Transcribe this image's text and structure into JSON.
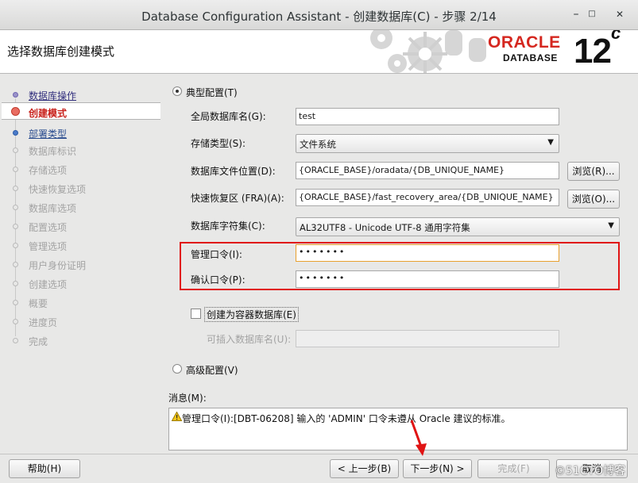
{
  "window": {
    "title": "Database Configuration Assistant - 创建数据库(C) - 步骤 2/14",
    "minimize": "–",
    "maximize": "□",
    "close": "✕"
  },
  "header": {
    "page_title": "选择数据库创建模式",
    "oracle": "ORACLE",
    "database": "DATABASE",
    "version": "12",
    "version_suffix": "c"
  },
  "sidebar": {
    "steps": [
      {
        "label": "数据库操作",
        "state": "done"
      },
      {
        "label": "创建模式",
        "state": "active"
      },
      {
        "label": "部署类型",
        "state": "next"
      },
      {
        "label": "数据库标识",
        "state": "disabled"
      },
      {
        "label": "存储选项",
        "state": "disabled"
      },
      {
        "label": "快速恢复选项",
        "state": "disabled"
      },
      {
        "label": "数据库选项",
        "state": "disabled"
      },
      {
        "label": "配置选项",
        "state": "disabled"
      },
      {
        "label": "管理选项",
        "state": "disabled"
      },
      {
        "label": "用户身份证明",
        "state": "disabled"
      },
      {
        "label": "创建选项",
        "state": "disabled"
      },
      {
        "label": "概要",
        "state": "disabled"
      },
      {
        "label": "进度页",
        "state": "disabled"
      },
      {
        "label": "完成",
        "state": "disabled"
      }
    ]
  },
  "form": {
    "typical_label": "典型配置(T)",
    "global_db_name_label": "全局数据库名(G):",
    "global_db_name_value": "test",
    "storage_type_label": "存储类型(S):",
    "storage_type_value": "文件系统",
    "db_file_location_label": "数据库文件位置(D):",
    "db_file_location_value": "{ORACLE_BASE}/oradata/{DB_UNIQUE_NAME}",
    "browse_r_label": "浏览(R)...",
    "fra_label": "快速恢复区 (FRA)(A):",
    "fra_value": "{ORACLE_BASE}/fast_recovery_area/{DB_UNIQUE_NAME}",
    "browse_o_label": "浏览(O)...",
    "charset_label": "数据库字符集(C):",
    "charset_value": "AL32UTF8 - Unicode UTF-8 通用字符集",
    "admin_pwd_label": "管理口令(I):",
    "admin_pwd_value": "•••••••",
    "confirm_pwd_label": "确认口令(P):",
    "confirm_pwd_value": "•••••••",
    "container_label": "创建为容器数据库(E)",
    "pdb_name_label": "可插入数据库名(U):",
    "advanced_label": "高级配置(V)"
  },
  "messages": {
    "label": "消息(M):",
    "text": "管理口令(I):[DBT-06208] 输入的 'ADMIN' 口令未遵从 Oracle 建议的标准。"
  },
  "footer": {
    "help": "帮助(H)",
    "back": "< 上一步(B)",
    "next": "下一步(N) >",
    "finish": "完成(F)",
    "cancel": "取消"
  },
  "watermark": "©51CTO博客",
  "colors": {
    "oracle_red": "#d5271f",
    "annotation_red": "#e01414",
    "active_step": "#c8201a"
  }
}
